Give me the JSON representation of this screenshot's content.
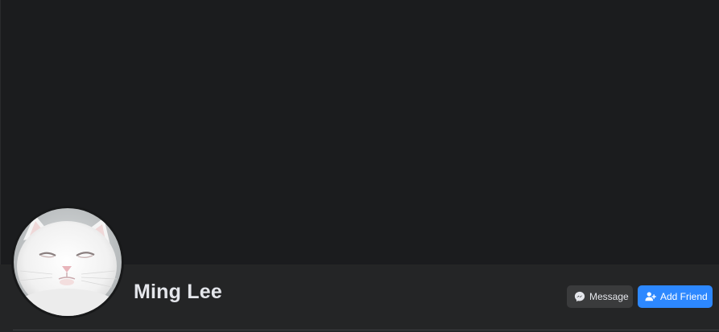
{
  "profile": {
    "name": "Ming Lee",
    "avatar_icon": "cat-profile-photo"
  },
  "actions": {
    "message_label": "Message",
    "message_icon": "messenger-icon",
    "add_friend_label": "Add Friend",
    "add_friend_icon": "add-friend-icon"
  },
  "colors": {
    "background": "#18191a",
    "bar": "#242526",
    "message_button": "#3a3b3c",
    "add_friend_button": "#2d88ff",
    "name_text": "#e4e6eb"
  }
}
